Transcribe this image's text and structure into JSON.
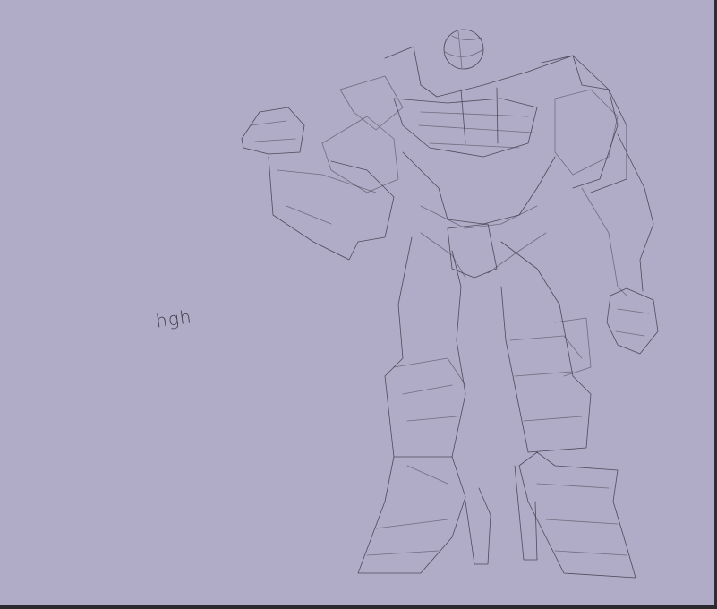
{
  "canvas": {
    "background_color": "#b0abc6",
    "stroke_color": "#3d3b49",
    "handwritten_text": "hgh",
    "drawing_subject_icon": "robot-sketch-icon"
  },
  "ui": {
    "scrollbar_color": "#2e2e33",
    "bottom_bar_color": "#2b2b2f"
  }
}
